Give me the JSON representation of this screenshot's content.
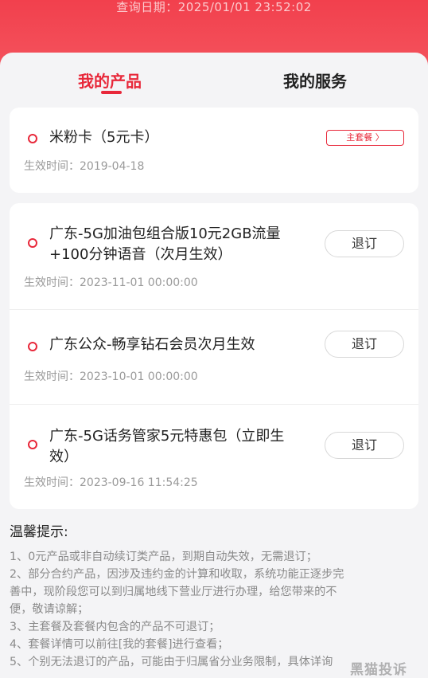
{
  "header": {
    "query_date": "查询日期：2025/01/01 23:52:02"
  },
  "tabs": [
    {
      "label": "我的产品",
      "active": true
    },
    {
      "label": "我的服务",
      "active": false
    }
  ],
  "main_product": {
    "name": "米粉卡（5元卡）",
    "badge": "主套餐 〉",
    "effective": "生效时间：2019-04-18"
  },
  "products": [
    {
      "name_line1": "广东-5G加油包组合版10元2GB流量",
      "name_line2": "+100分钟语音（次月生效）",
      "effective": "生效时间：2023-11-01 00:00:00",
      "action": "退订"
    },
    {
      "name_line1": "广东公众-畅享钻石会员次月生效",
      "name_line2": "",
      "effective": "生效时间：2023-10-01 00:00:00",
      "action": "退订"
    },
    {
      "name_line1": "广东-5G话务管家5元特惠包（立即生",
      "name_line2": "效）",
      "effective": "生效时间：2023-09-16 11:54:25",
      "action": "退订"
    }
  ],
  "tips": {
    "title": "温馨提示:",
    "lines": [
      "1、0元产品或非自动续订类产品，到期自动失效，无需退订；",
      "2、部分合约产品，因涉及违约金的计算和收取，系统功能正逐步完",
      "善中，现阶段您可以到归属地线下营业厅进行办理，给您带来的不",
      "便，敬请谅解；",
      "3、主套餐及套餐内包含的产品不可退订；",
      "4、套餐详情可以前往[我的套餐]进行查看；",
      "5、个别无法退订的产品，可能由于归属省分业务限制，具体详询"
    ]
  },
  "watermark": "黑猫投诉"
}
